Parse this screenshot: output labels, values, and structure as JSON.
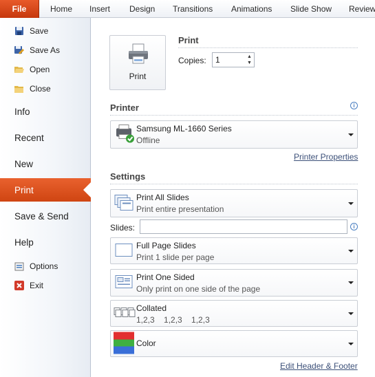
{
  "ribbon": {
    "tabs": [
      {
        "label": "File"
      },
      {
        "label": "Home"
      },
      {
        "label": "Insert"
      },
      {
        "label": "Design"
      },
      {
        "label": "Transitions"
      },
      {
        "label": "Animations"
      },
      {
        "label": "Slide Show"
      },
      {
        "label": "Review"
      }
    ]
  },
  "nav": {
    "commands": [
      {
        "label": "Save",
        "icon": "save-icon"
      },
      {
        "label": "Save As",
        "icon": "save-as-icon"
      },
      {
        "label": "Open",
        "icon": "open-folder-icon"
      },
      {
        "label": "Close",
        "icon": "close-folder-icon"
      }
    ],
    "items": [
      {
        "label": "Info"
      },
      {
        "label": "Recent"
      },
      {
        "label": "New"
      },
      {
        "label": "Print",
        "active": true
      },
      {
        "label": "Save & Send"
      },
      {
        "label": "Help"
      }
    ],
    "bottom": [
      {
        "label": "Options",
        "icon": "options-icon"
      },
      {
        "label": "Exit",
        "icon": "exit-icon"
      }
    ],
    "accent_color": "#d24a16"
  },
  "print": {
    "heading": "Print",
    "button_label": "Print",
    "copies_label": "Copies:",
    "copies_value": "1"
  },
  "printer": {
    "heading": "Printer",
    "name": "Samsung ML-1660 Series",
    "status": "Offline",
    "properties_link": "Printer Properties"
  },
  "settings": {
    "heading": "Settings",
    "slides_label": "Slides:",
    "slides_value": "",
    "dropdowns": [
      {
        "title": "Print All Slides",
        "subtitle": "Print entire presentation"
      },
      {
        "title": "Full Page Slides",
        "subtitle": "Print 1 slide per page"
      },
      {
        "title": "Print One Sided",
        "subtitle": "Only print on one side of the page"
      },
      {
        "title": "Collated",
        "subtitle": "1,2,3    1,2,3    1,2,3"
      },
      {
        "title": "Color",
        "subtitle": ""
      }
    ],
    "footer_link": "Edit Header & Footer"
  }
}
